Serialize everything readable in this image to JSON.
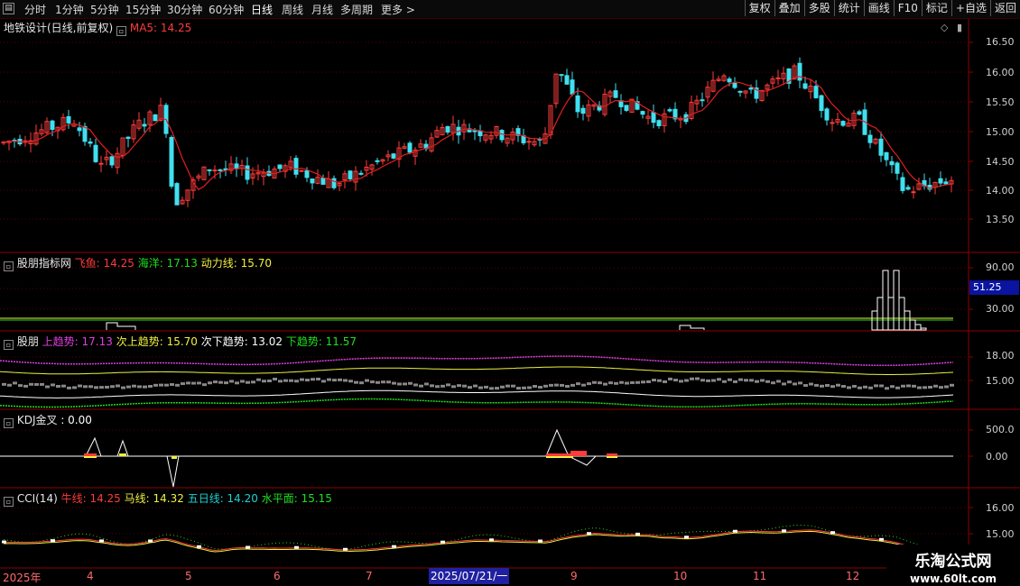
{
  "toolbar": {
    "periods": [
      "分时",
      "1分钟",
      "5分钟",
      "15分钟",
      "30分钟",
      "60分钟",
      "日线",
      "周线",
      "月线",
      "多周期",
      "更多 >"
    ],
    "active_period": "日线",
    "buttons": [
      "复权",
      "叠加",
      "多股",
      "统计",
      "画线",
      "F10",
      "标记",
      "+自选",
      "返回"
    ]
  },
  "main_panel": {
    "stock_title": "地铁设计(日线,前复权)",
    "ma_label": "MA5: 14.25",
    "y_ticks": [
      "16.50",
      "16.00",
      "15.50",
      "15.00",
      "14.50",
      "14.00",
      "13.50"
    ]
  },
  "panel2": {
    "name": "股朋指标网",
    "items": [
      {
        "label": "飞鱼: 14.25",
        "color": "#ff3b3b"
      },
      {
        "label": "海洋: 17.13",
        "color": "#1ee01e"
      },
      {
        "label": "动力线: 15.70",
        "color": "#f0f040"
      }
    ],
    "y_ticks": [
      "90.00",
      "30.00"
    ],
    "current_value": "51.25"
  },
  "panel3": {
    "name": "股朋",
    "items": [
      {
        "label": "上趋势: 17.13",
        "color": "#e040e0"
      },
      {
        "label": "次上趋势: 15.70",
        "color": "#f0f040"
      },
      {
        "label": "次下趋势: 13.02",
        "color": "#ffffff"
      },
      {
        "label": "下趋势: 11.57",
        "color": "#1ee01e"
      }
    ],
    "y_ticks": [
      "18.00",
      "15.00"
    ]
  },
  "panel4": {
    "name": "KDJ金叉",
    "items": [
      {
        "label": ": 0.00",
        "color": "#ffffff"
      }
    ],
    "y_ticks": [
      "500.0",
      "0.00"
    ]
  },
  "panel5": {
    "name": "CCI(14)",
    "items": [
      {
        "label": "牛线: 14.25",
        "color": "#ff3b3b"
      },
      {
        "label": "马线: 14.32",
        "color": "#f0f040"
      },
      {
        "label": "五日线: 14.20",
        "color": "#20d0d0"
      },
      {
        "label": "水平面: 15.15",
        "color": "#1ee01e"
      }
    ],
    "y_ticks": [
      "16.00",
      "15.00"
    ]
  },
  "date_axis": {
    "labels": [
      "2025年",
      "4",
      "5",
      "6",
      "7",
      "2025/07/21/一",
      "9",
      "10",
      "11",
      "12"
    ],
    "cursor_date": "2025/07/21/一"
  },
  "watermark": {
    "title": "乐淘公式网",
    "url": "www.60lt.com"
  },
  "colors": {
    "up": "#ff3b3b",
    "down": "#40e0f0",
    "ma": "#e02020",
    "grid": "#5a0000",
    "axis": "#8b0000"
  }
}
